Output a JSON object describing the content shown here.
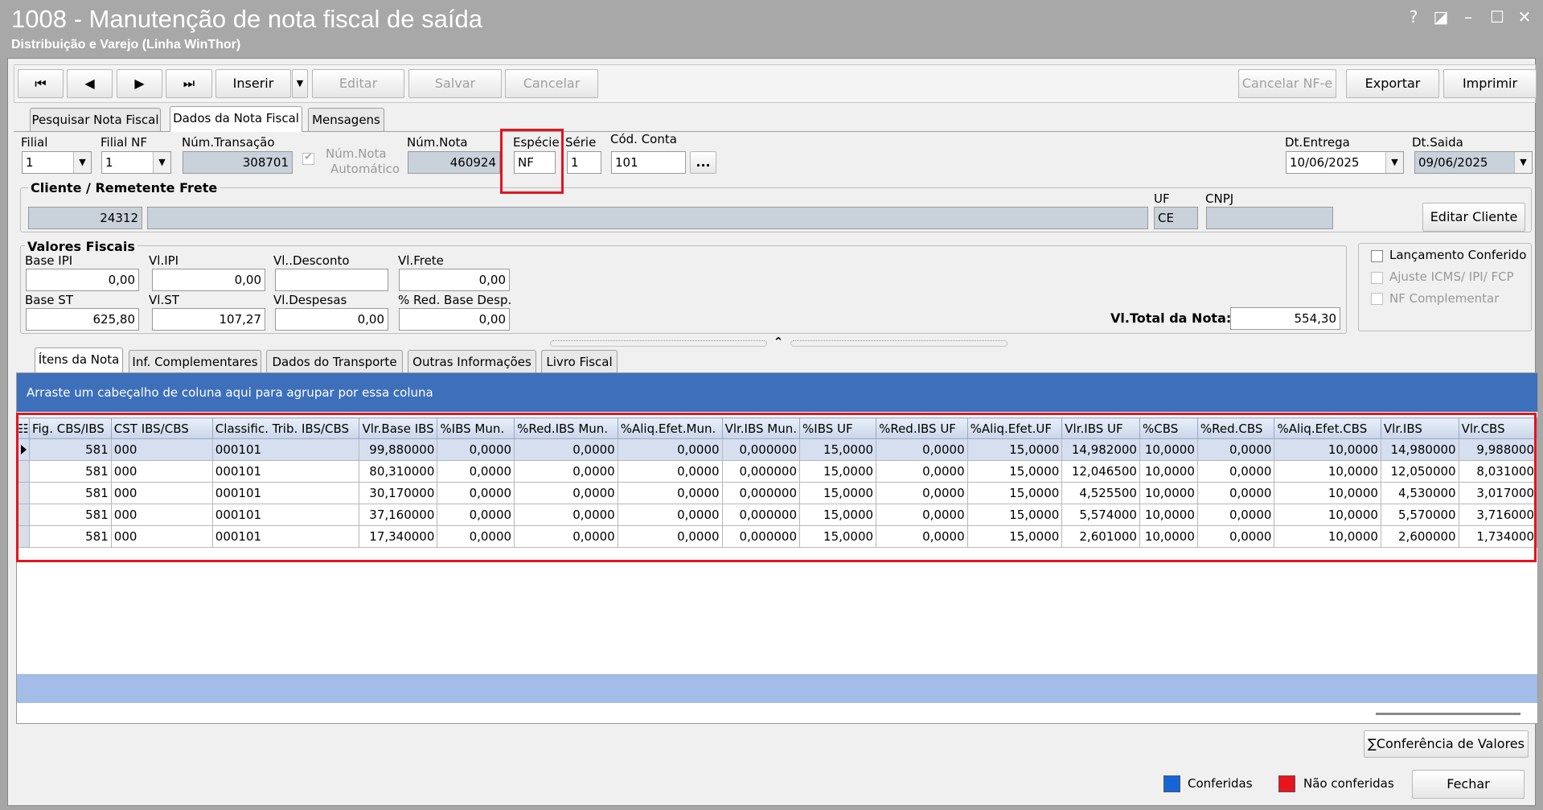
{
  "window": {
    "title": "1008 - Manutenção de nota fiscal de saída",
    "subtitle": "Distribuição e Varejo (Linha WinThor)",
    "help": "?",
    "restore": "◪",
    "minimize": "–",
    "maximize": "☐",
    "close": "✕"
  },
  "toolbar": {
    "first": "⏮",
    "prev": "◀",
    "next": "▶",
    "last": "⏭",
    "insert": "Inserir",
    "insert_menu": "▼",
    "edit": "Editar",
    "save": "Salvar",
    "cancel": "Cancelar",
    "cancel_nfe": "Cancelar NF-e",
    "export": "Exportar",
    "print": "Imprimir"
  },
  "main_tabs": [
    "Pesquisar Nota Fiscal",
    "Dados da Nota Fiscal",
    "Mensagens"
  ],
  "header_fields": {
    "filial_label": "Filial",
    "filial_value": "1",
    "filial_nf_label": "Filial NF",
    "filial_nf_value": "1",
    "num_transacao_label": "Núm.Transação",
    "num_transacao_value": "308701",
    "num_nota_auto_label1": "Núm.Nota",
    "num_nota_auto_label2": "Automático",
    "num_nota_label": "Núm.Nota",
    "num_nota_value": "460924",
    "especie_label": "Espécie",
    "especie_value": "NF",
    "serie_label": "Série",
    "serie_value": "1",
    "cod_conta_label": "Cód. Conta",
    "cod_conta_value": "101",
    "cod_conta_lookup": "...",
    "dt_entrega_label": "Dt.Entrega",
    "dt_entrega_value": "10/06/2025",
    "dt_saida_label": "Dt.Saida",
    "dt_saida_value": "09/06/2025"
  },
  "cliente": {
    "group_title": "Cliente / Remetente Frete",
    "code": "24312",
    "name": "",
    "uf_label": "UF",
    "uf_value": "CE",
    "cnpj_label": "CNPJ",
    "cnpj_value": "",
    "edit_button": "Editar Cliente"
  },
  "valores": {
    "group_title": "Valores Fiscais",
    "base_ipi_label": "Base IPI",
    "base_ipi": "0,00",
    "vl_ipi_label": "Vl.IPI",
    "vl_ipi": "0,00",
    "vl_desconto_label": "Vl..Desconto",
    "vl_desconto": "",
    "vl_frete_label": "Vl.Frete",
    "vl_frete": "0,00",
    "base_st_label": "Base ST",
    "base_st": "625,80",
    "vl_st_label": "Vl.ST",
    "vl_st": "107,27",
    "vl_despesas_label": "Vl.Despesas",
    "vl_despesas": "0,00",
    "red_base_desp_label": "% Red. Base Desp.",
    "red_base_desp": "0,00",
    "vl_total_label": "Vl.Total da Nota:",
    "vl_total": "554,30"
  },
  "flags": {
    "lancamento_conferido": "Lançamento Conferido",
    "ajuste_icms": "Ajuste ICMS/ IPI/ FCP",
    "nf_complementar": "NF Complementar"
  },
  "splitter": "⌃",
  "detail_tabs": [
    "Ítens da Nota",
    "Inf. Complementares",
    "Dados do Transporte",
    "Outras Informações",
    "Livro Fiscal"
  ],
  "grid": {
    "group_hint": "Arraste um cabeçalho de coluna aqui para agrupar por essa coluna",
    "columns_icon": "☷",
    "columns": [
      "Fig. CBS/IBS",
      "CST IBS/CBS",
      "Classific. Trib. IBS/CBS",
      "Vlr.Base IBS",
      "%IBS Mun.",
      "%Red.IBS Mun.",
      "%Aliq.Efet.Mun.",
      "Vlr.IBS Mun.",
      "%IBS UF",
      "%Red.IBS UF",
      "%Aliq.Efet.UF",
      "Vlr.IBS UF",
      "%CBS",
      "%Red.CBS",
      "%Aliq.Efet.CBS",
      "Vlr.IBS",
      "Vlr.CBS"
    ],
    "rows": [
      [
        "581",
        "000",
        "000101",
        "99,880000",
        "0,0000",
        "0,0000",
        "0,0000",
        "0,000000",
        "15,0000",
        "0,0000",
        "15,0000",
        "14,982000",
        "10,0000",
        "0,0000",
        "10,0000",
        "14,980000",
        "9,988000"
      ],
      [
        "581",
        "000",
        "000101",
        "80,310000",
        "0,0000",
        "0,0000",
        "0,0000",
        "0,000000",
        "15,0000",
        "0,0000",
        "15,0000",
        "12,046500",
        "10,0000",
        "0,0000",
        "10,0000",
        "12,050000",
        "8,031000"
      ],
      [
        "581",
        "000",
        "000101",
        "30,170000",
        "0,0000",
        "0,0000",
        "0,0000",
        "0,000000",
        "15,0000",
        "0,0000",
        "15,0000",
        "4,525500",
        "10,0000",
        "0,0000",
        "10,0000",
        "4,530000",
        "3,017000"
      ],
      [
        "581",
        "000",
        "000101",
        "37,160000",
        "0,0000",
        "0,0000",
        "0,0000",
        "0,000000",
        "15,0000",
        "0,0000",
        "15,0000",
        "5,574000",
        "10,0000",
        "0,0000",
        "10,0000",
        "5,570000",
        "3,716000"
      ],
      [
        "581",
        "000",
        "000101",
        "17,340000",
        "0,0000",
        "0,0000",
        "0,0000",
        "0,000000",
        "15,0000",
        "0,0000",
        "15,0000",
        "2,601000",
        "10,0000",
        "0,0000",
        "10,0000",
        "2,600000",
        "1,734000"
      ]
    ]
  },
  "footer": {
    "conferencia_button": "Conferência de Valores",
    "sigma": "∑",
    "legend_conferidas": "Conferidas",
    "legend_nao_conferidas": "Não conferidas",
    "close_button": "Fechar"
  },
  "colors": {
    "title_bar": "#a8a8a8",
    "group_banner": "#3e6fba",
    "legend_conferidas": "#1565d8",
    "legend_nao_conferidas": "#e8141e",
    "highlight": "#e2141e"
  }
}
